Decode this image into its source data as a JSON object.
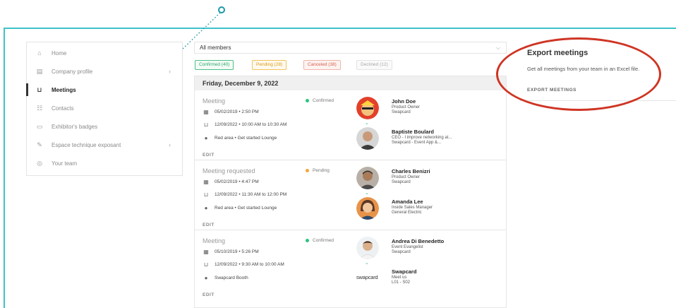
{
  "sidebar": {
    "items": [
      {
        "label": "Home",
        "icon": "home-icon",
        "glyph": "⌂",
        "active": false,
        "chevron": false
      },
      {
        "label": "Company profile",
        "icon": "company-icon",
        "glyph": "▤",
        "active": false,
        "chevron": true
      },
      {
        "label": "Meetings",
        "icon": "meetings-icon",
        "glyph": "⊔",
        "active": true,
        "chevron": false
      },
      {
        "label": "Contacts",
        "icon": "contacts-icon",
        "glyph": "☷",
        "active": false,
        "chevron": false
      },
      {
        "label": "Exhibitor's badges",
        "icon": "badge-icon",
        "glyph": "▭",
        "active": false,
        "chevron": false
      },
      {
        "label": "Espace technique exposant",
        "icon": "wrench-icon",
        "glyph": "✎",
        "active": false,
        "chevron": true
      },
      {
        "label": "Your team",
        "icon": "team-icon",
        "glyph": "◎",
        "active": false,
        "chevron": false
      }
    ]
  },
  "filter": {
    "members_value": "All members",
    "chevron": "⌵",
    "tabs": {
      "confirmed": "Confirmed (40)",
      "pending": "Pending (28)",
      "canceled": "Canceled (38)",
      "declined": "Declined (12)"
    }
  },
  "list": {
    "date": "Friday, December 9, 2022",
    "meetings": [
      {
        "title": "Meeting",
        "status": "Confirmed",
        "created": "05/02/2019 • 2:50 PM",
        "time": "12/09/2022 • 10:00 AM to 10:30 AM",
        "location": "Red area • Get started Lounge",
        "edit": "EDIT",
        "people": [
          {
            "name": "John Doe",
            "role": "Product Owner",
            "company": "Swapcard"
          },
          {
            "name": "Baptiste Boulard",
            "role": "CEO - I improve networking at...",
            "company": "Swapcard - Event App &..."
          }
        ]
      },
      {
        "title": "Meeting requested",
        "status": "Pending",
        "created": "05/02/2019 • 4:47 PM",
        "time": "12/09/2022 • 11:30 AM to 12:00 PM",
        "location": "Red area • Get started Lounge",
        "edit": "EDIT",
        "people": [
          {
            "name": "Charles Benizri",
            "role": "Product Owner",
            "company": "Swapcard"
          },
          {
            "name": "Amanda Lee",
            "role": "Inside Sales Manager",
            "company": "General Electric"
          }
        ]
      },
      {
        "title": "Meeting",
        "status": "Confirmed",
        "created": "05/10/2019 • 5:26 PM",
        "time": "12/09/2022 • 9:30 AM to 10:00 AM",
        "location": "Swapcard Booth",
        "edit": "EDIT",
        "people": [
          {
            "name": "Andrea Di Benedetto",
            "role": "Event Evangelist",
            "company": "Swapcard"
          },
          {
            "name": "Swapcard",
            "role": "Meet us",
            "company": "L01 - S02"
          }
        ]
      }
    ],
    "logo_text": "swapcard"
  },
  "export": {
    "title": "Export meetings",
    "description": "Get all meetings from your team in an Excel file.",
    "link": "EXPORT MEETINGS"
  },
  "colors": {
    "teal": "#3ec3c9",
    "annotation_red": "#cf3524",
    "confirmed_green": "#2ec27e",
    "pending_orange": "#f3a73b"
  }
}
